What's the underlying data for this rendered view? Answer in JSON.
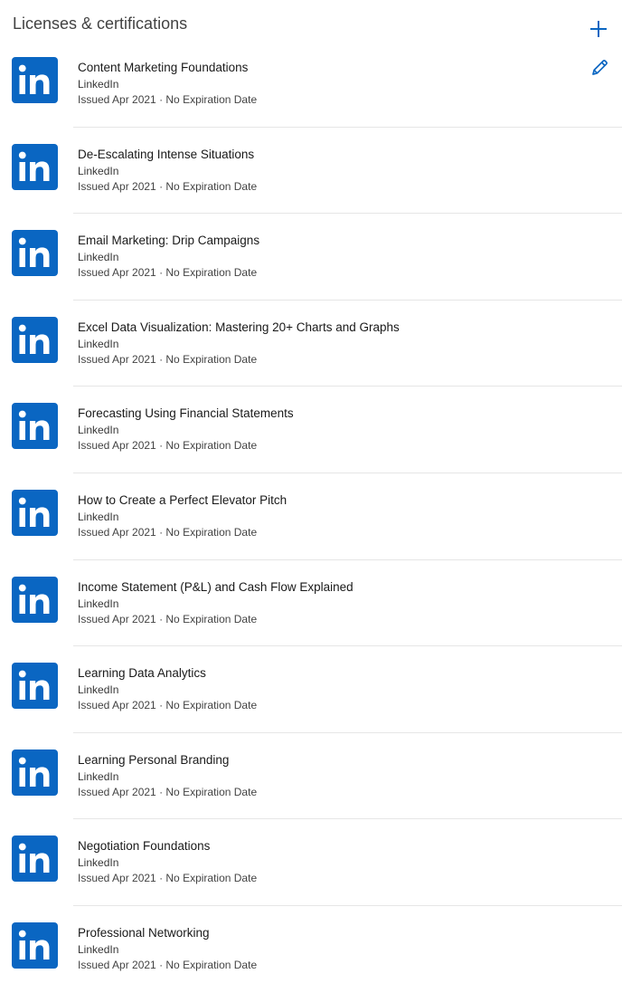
{
  "section": {
    "title": "Licenses & certifications",
    "add_icon": "plus-icon",
    "edit_icon": "pencil-icon",
    "accent_color": "#0a66c2"
  },
  "certifications": [
    {
      "name": "Content Marketing Foundations",
      "issuer": "LinkedIn",
      "issued": "Issued Apr 2021 · No Expiration Date",
      "logo": "linkedin-logo"
    },
    {
      "name": "De-Escalating Intense Situations",
      "issuer": "LinkedIn",
      "issued": "Issued Apr 2021 · No Expiration Date",
      "logo": "linkedin-logo"
    },
    {
      "name": "Email Marketing: Drip Campaigns",
      "issuer": "LinkedIn",
      "issued": "Issued Apr 2021 · No Expiration Date",
      "logo": "linkedin-logo"
    },
    {
      "name": "Excel Data Visualization: Mastering 20+ Charts and Graphs",
      "issuer": "LinkedIn",
      "issued": "Issued Apr 2021 · No Expiration Date",
      "logo": "linkedin-logo"
    },
    {
      "name": "Forecasting Using Financial Statements",
      "issuer": "LinkedIn",
      "issued": "Issued Apr 2021 · No Expiration Date",
      "logo": "linkedin-logo"
    },
    {
      "name": "How to Create a Perfect Elevator Pitch",
      "issuer": "LinkedIn",
      "issued": "Issued Apr 2021 · No Expiration Date",
      "logo": "linkedin-logo"
    },
    {
      "name": "Income Statement (P&L) and Cash Flow Explained",
      "issuer": "LinkedIn",
      "issued": "Issued Apr 2021 · No Expiration Date",
      "logo": "linkedin-logo"
    },
    {
      "name": "Learning Data Analytics",
      "issuer": "LinkedIn",
      "issued": "Issued Apr 2021 · No Expiration Date",
      "logo": "linkedin-logo"
    },
    {
      "name": "Learning Personal Branding",
      "issuer": "LinkedIn",
      "issued": "Issued Apr 2021 · No Expiration Date",
      "logo": "linkedin-logo"
    },
    {
      "name": "Negotiation Foundations",
      "issuer": "LinkedIn",
      "issued": "Issued Apr 2021 · No Expiration Date",
      "logo": "linkedin-logo"
    },
    {
      "name": "Professional Networking",
      "issuer": "LinkedIn",
      "issued": "Issued Apr 2021 · No Expiration Date",
      "logo": "linkedin-logo"
    }
  ]
}
